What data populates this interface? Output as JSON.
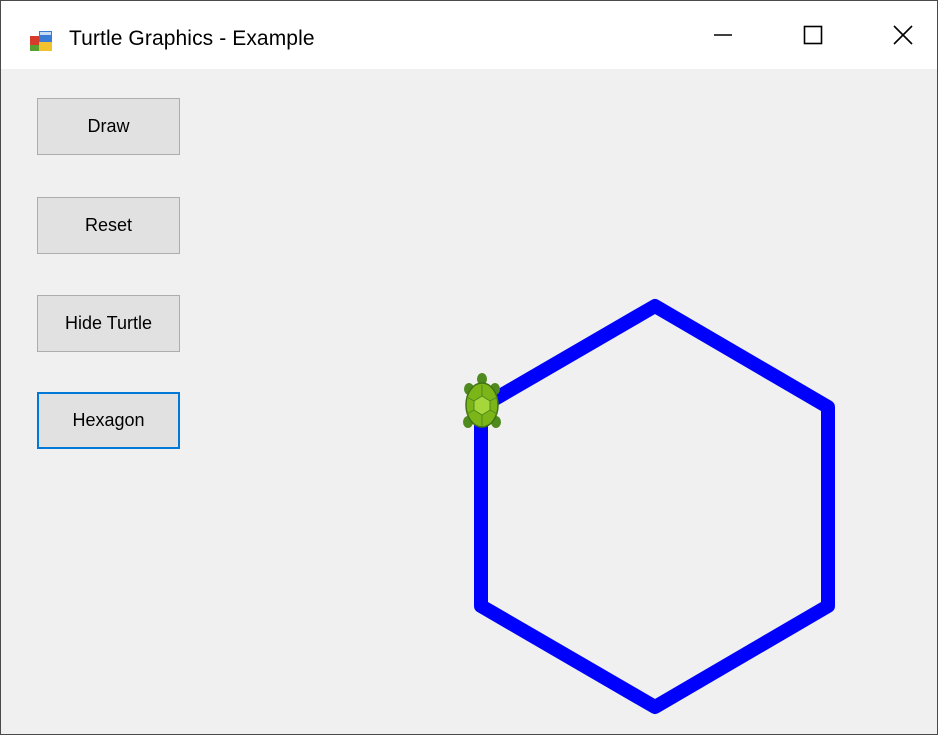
{
  "window": {
    "title": "Turtle Graphics - Example",
    "icon": "windows-forms-app-icon",
    "controls": {
      "minimize_icon": "minimize-icon",
      "maximize_icon": "maximize-icon",
      "close_icon": "close-icon"
    }
  },
  "toolbar": {
    "buttons": [
      {
        "label": "Draw"
      },
      {
        "label": "Reset"
      },
      {
        "label": "Hide Turtle"
      },
      {
        "label": "Hexagon",
        "focused": true
      }
    ]
  },
  "drawing": {
    "shape": "hexagon",
    "pen_color": "#0000ff",
    "turtle_icon": "turtle-icon",
    "turtle_color": "#7cb518"
  }
}
